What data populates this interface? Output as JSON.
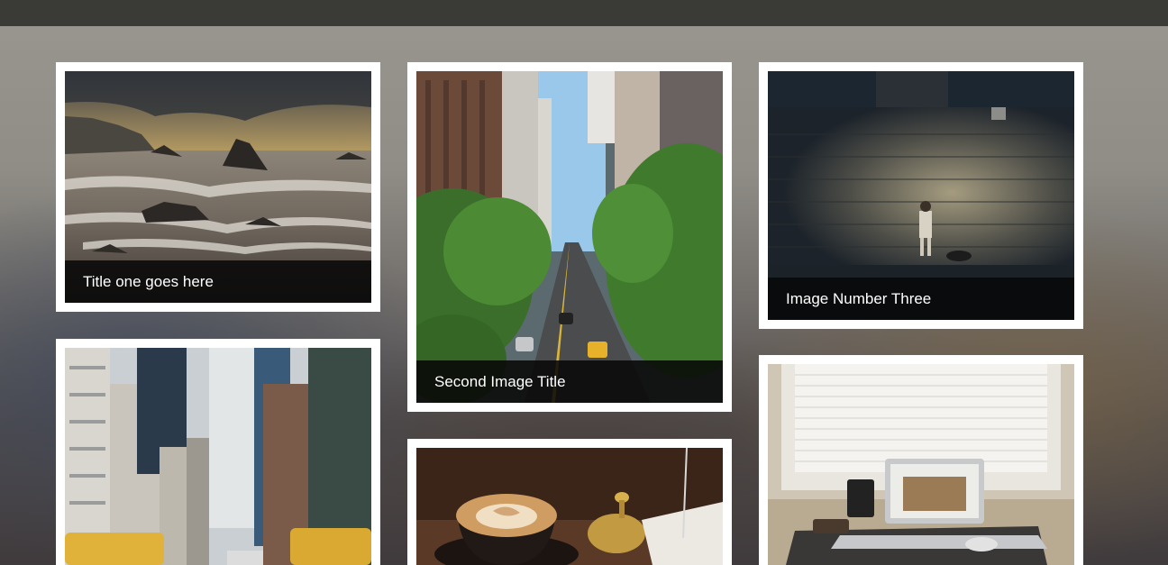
{
  "gallery": {
    "items": [
      {
        "title": "Title one goes here",
        "photo": "rocky-seashore-sunset"
      },
      {
        "title": "Second Image Title",
        "photo": "city-avenue-trees"
      },
      {
        "title": "Image Number Three",
        "photo": "child-dog-lit-wall"
      },
      {
        "title": "",
        "photo": "city-street-taxis"
      },
      {
        "title": "",
        "photo": "latte-coffee-cup-bell"
      },
      {
        "title": "",
        "photo": "laptop-on-desk-window"
      }
    ]
  }
}
